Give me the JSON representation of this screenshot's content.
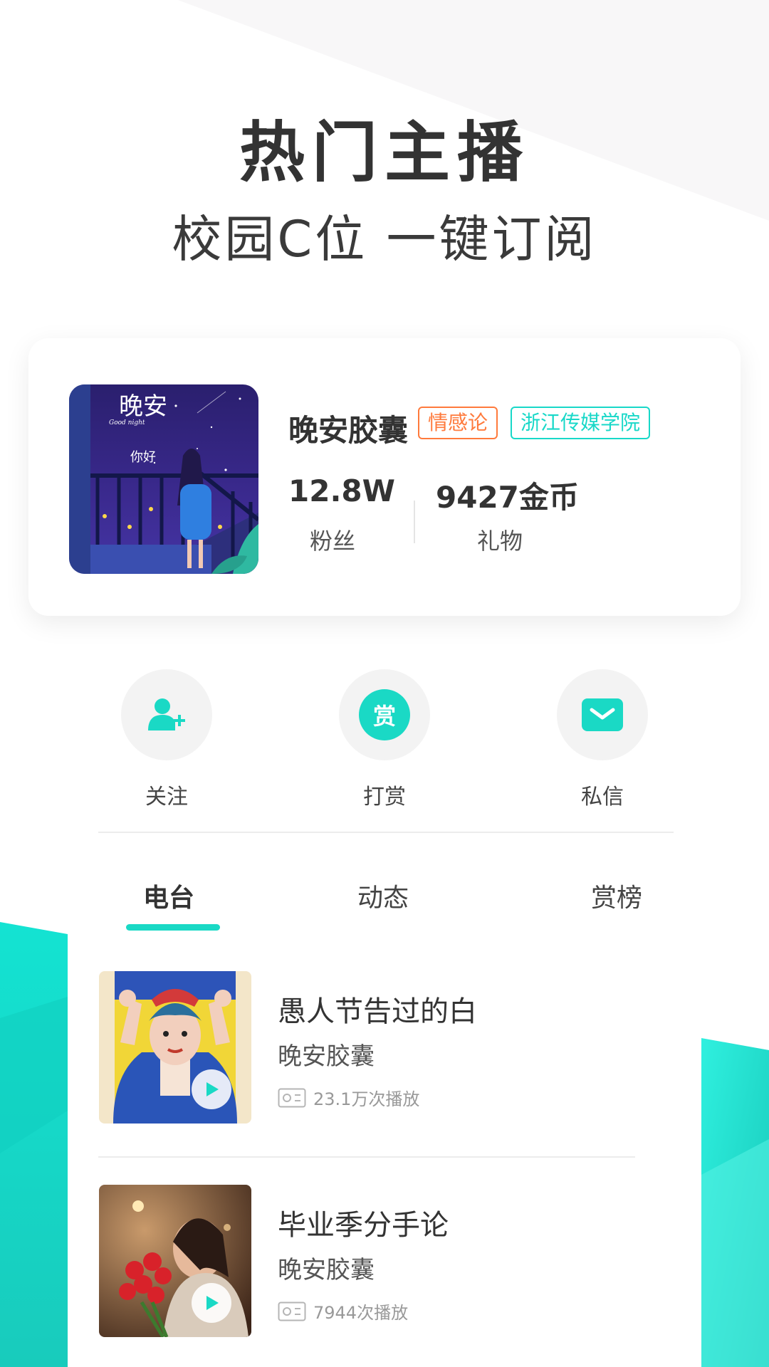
{
  "hero": {
    "title": "热门主播",
    "subtitle": "校园C位 一键订阅"
  },
  "host": {
    "cover_text": "晚安你好",
    "cover_caption": "Good night",
    "name": "晚安胶囊",
    "tags": [
      "情感论",
      "浙江传媒学院"
    ],
    "stats": [
      {
        "value": "12.8W",
        "label": "粉丝"
      },
      {
        "value": "9427金币",
        "label": "礼物"
      }
    ]
  },
  "actions": [
    {
      "label": "关注",
      "icon": "follow-icon"
    },
    {
      "label": "打赏",
      "icon": "reward-icon",
      "glyph": "赏"
    },
    {
      "label": "私信",
      "icon": "mail-icon"
    }
  ],
  "tabs": [
    {
      "label": "电台",
      "active": true
    },
    {
      "label": "动态",
      "active": false
    },
    {
      "label": "赏榜",
      "active": false
    }
  ],
  "programs": [
    {
      "title": "愚人节告过的白",
      "author": "晚安胶囊",
      "plays": "23.1万次播放"
    },
    {
      "title": "毕业季分手论",
      "author": "晚安胶囊",
      "plays": "7944次播放"
    }
  ],
  "colors": {
    "accent": "#1ad9c5",
    "tag_orange": "#ff7a3c",
    "text_dark": "#333333"
  }
}
